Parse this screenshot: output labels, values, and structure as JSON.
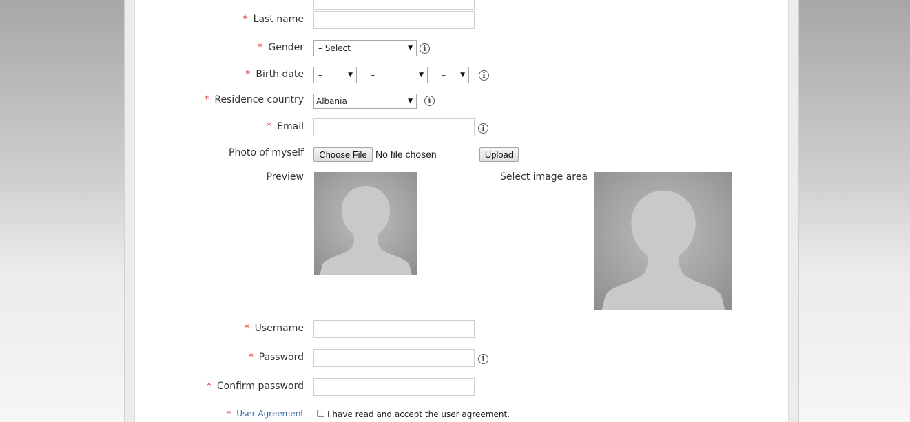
{
  "form": {
    "required_mark": "*",
    "last_name": {
      "label": "Last name",
      "value": ""
    },
    "gender": {
      "label": "Gender",
      "selected": "– Select"
    },
    "birth_date": {
      "label": "Birth date",
      "day": "–",
      "month": "–",
      "year": "–"
    },
    "residence_country": {
      "label": "Residence country",
      "selected": "Albania"
    },
    "email": {
      "label": "Email",
      "value": ""
    },
    "photo": {
      "label": "Photo of myself",
      "choose_file": "Choose File",
      "no_file": "No file chosen",
      "upload": "Upload",
      "preview_label": "Preview",
      "select_area_label": "Select image area"
    },
    "username": {
      "label": "Username",
      "value": ""
    },
    "password": {
      "label": "Password",
      "value": ""
    },
    "confirm_password": {
      "label": "Confirm password",
      "value": ""
    },
    "agreement": {
      "label": "User Agreement",
      "checkbox_text": "I have read and accept the user agreement.",
      "checked": false
    }
  },
  "icons": {
    "info": "info-circle-icon",
    "dropdown": "triangle-down-icon",
    "avatar": "person-silhouette-placeholder"
  },
  "colors": {
    "required": "#d9302c",
    "link": "#3b6ea5",
    "text": "#333333"
  }
}
